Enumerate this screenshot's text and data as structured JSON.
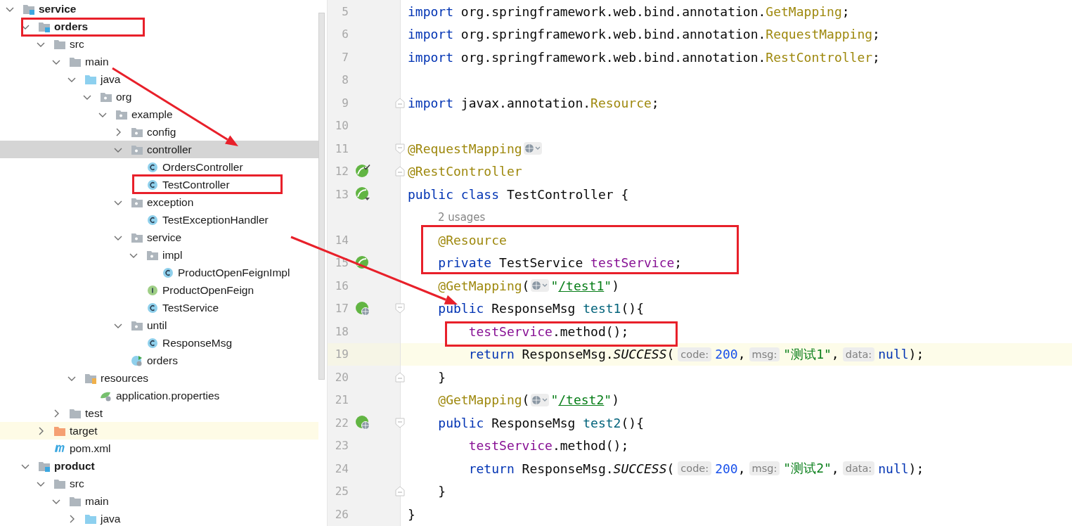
{
  "project_tree": {
    "items": [
      {
        "label": "service",
        "kind": "module",
        "bold": true,
        "selected": false,
        "expanded": true,
        "children": [
          {
            "label": "orders",
            "kind": "module",
            "bold": true,
            "selected": false,
            "expanded": true,
            "children": [
              {
                "label": "src",
                "kind": "folder",
                "bold": false,
                "selected": false,
                "expanded": true,
                "children": [
                  {
                    "label": "main",
                    "kind": "folder",
                    "bold": false,
                    "selected": false,
                    "expanded": true,
                    "children": [
                      {
                        "label": "java",
                        "kind": "source",
                        "bold": false,
                        "selected": false,
                        "expanded": true,
                        "children": [
                          {
                            "label": "org",
                            "kind": "package",
                            "bold": false,
                            "selected": false,
                            "expanded": true,
                            "children": [
                              {
                                "label": "example",
                                "kind": "package",
                                "bold": false,
                                "selected": false,
                                "expanded": true,
                                "children": [
                                  {
                                    "label": "config",
                                    "kind": "package",
                                    "bold": false,
                                    "selected": false,
                                    "expanded": false
                                  },
                                  {
                                    "label": "controller",
                                    "kind": "package",
                                    "bold": false,
                                    "selected": true,
                                    "expanded": true,
                                    "children": [
                                      {
                                        "label": "OrdersController",
                                        "kind": "class",
                                        "bold": false,
                                        "selected": false
                                      },
                                      {
                                        "label": "TestController",
                                        "kind": "class",
                                        "bold": false,
                                        "selected": false
                                      }
                                    ]
                                  },
                                  {
                                    "label": "exception",
                                    "kind": "package",
                                    "bold": false,
                                    "selected": false,
                                    "expanded": true,
                                    "children": [
                                      {
                                        "label": "TestExceptionHandler",
                                        "kind": "class",
                                        "bold": false,
                                        "selected": false
                                      }
                                    ]
                                  },
                                  {
                                    "label": "service",
                                    "kind": "package",
                                    "bold": false,
                                    "selected": false,
                                    "expanded": true,
                                    "children": [
                                      {
                                        "label": "impl",
                                        "kind": "package",
                                        "bold": false,
                                        "selected": false,
                                        "expanded": true,
                                        "children": [
                                          {
                                            "label": "ProductOpenFeignImpl",
                                            "kind": "class",
                                            "bold": false,
                                            "selected": false
                                          }
                                        ]
                                      },
                                      {
                                        "label": "ProductOpenFeign",
                                        "kind": "interface",
                                        "bold": false,
                                        "selected": false
                                      },
                                      {
                                        "label": "TestService",
                                        "kind": "class",
                                        "bold": false,
                                        "selected": false
                                      }
                                    ]
                                  },
                                  {
                                    "label": "until",
                                    "kind": "package",
                                    "bold": false,
                                    "selected": false,
                                    "expanded": true,
                                    "children": [
                                      {
                                        "label": "ResponseMsg",
                                        "kind": "class",
                                        "bold": false,
                                        "selected": false
                                      }
                                    ]
                                  },
                                  {
                                    "label": "orders",
                                    "kind": "bootclass",
                                    "bold": false,
                                    "selected": false
                                  }
                                ]
                              }
                            ]
                          }
                        ]
                      },
                      {
                        "label": "resources",
                        "kind": "resources",
                        "bold": false,
                        "selected": false,
                        "expanded": true,
                        "children": [
                          {
                            "label": "application.properties",
                            "kind": "config",
                            "bold": false,
                            "selected": false
                          }
                        ]
                      }
                    ]
                  },
                  {
                    "label": "test",
                    "kind": "folder",
                    "bold": false,
                    "selected": false,
                    "expanded": false
                  }
                ]
              },
              {
                "label": "target",
                "kind": "excluded",
                "bold": false,
                "selected": false,
                "expanded": false
              },
              {
                "label": "pom.xml",
                "kind": "maven",
                "bold": false,
                "selected": false
              }
            ]
          },
          {
            "label": "product",
            "kind": "module",
            "bold": true,
            "selected": false,
            "expanded": true,
            "children": [
              {
                "label": "src",
                "kind": "folder",
                "bold": false,
                "selected": false,
                "expanded": true,
                "children": [
                  {
                    "label": "main",
                    "kind": "folder",
                    "bold": false,
                    "selected": false,
                    "expanded": true,
                    "children": [
                      {
                        "label": "java",
                        "kind": "source",
                        "bold": false,
                        "selected": false,
                        "expanded": false
                      }
                    ]
                  }
                ]
              }
            ]
          }
        ]
      }
    ]
  },
  "editor": {
    "lines": [
      {
        "kind": "code",
        "number": "5",
        "current": false,
        "tokens": [
          {
            "kind": "kw",
            "text": "import"
          },
          {
            "kind": "plain",
            "text": " org.springframework.web.bind.annotation."
          },
          {
            "kind": "ann",
            "text": "GetMapping"
          },
          {
            "kind": "plain",
            "text": ";"
          }
        ]
      },
      {
        "kind": "code",
        "number": "6",
        "current": false,
        "tokens": [
          {
            "kind": "kw",
            "text": "import"
          },
          {
            "kind": "plain",
            "text": " org.springframework.web.bind.annotation."
          },
          {
            "kind": "ann",
            "text": "RequestMapping"
          },
          {
            "kind": "plain",
            "text": ";"
          }
        ]
      },
      {
        "kind": "code",
        "number": "7",
        "current": false,
        "tokens": [
          {
            "kind": "kw",
            "text": "import"
          },
          {
            "kind": "plain",
            "text": " org.springframework.web.bind.annotation."
          },
          {
            "kind": "ann",
            "text": "RestController"
          },
          {
            "kind": "plain",
            "text": ";"
          }
        ]
      },
      {
        "kind": "code",
        "number": "8",
        "current": false
      },
      {
        "kind": "code",
        "number": "9",
        "current": false,
        "markers": [
          {
            "kind": "fold-end"
          }
        ],
        "tokens": [
          {
            "kind": "kw",
            "text": "import"
          },
          {
            "kind": "plain",
            "text": " javax.annotation."
          },
          {
            "kind": "ann",
            "text": "Resource"
          },
          {
            "kind": "plain",
            "text": ";"
          }
        ]
      },
      {
        "kind": "code",
        "number": "10",
        "current": false
      },
      {
        "kind": "code",
        "number": "11",
        "current": false,
        "markers": [
          {
            "kind": "fold-start"
          }
        ],
        "tokens": [
          {
            "kind": "ann",
            "text": "@RequestMapping"
          },
          {
            "kind": "globe"
          }
        ]
      },
      {
        "kind": "code",
        "number": "12",
        "current": false,
        "markers": [
          {
            "kind": "bean-check"
          },
          {
            "kind": "fold-end"
          }
        ],
        "tokens": [
          {
            "kind": "ann",
            "text": "@RestController"
          }
        ]
      },
      {
        "kind": "code",
        "number": "13",
        "current": false,
        "markers": [
          {
            "kind": "bean-down"
          }
        ],
        "tokens": [
          {
            "kind": "kw",
            "text": "public class"
          },
          {
            "kind": "plain",
            "text": " TestController {"
          }
        ]
      },
      {
        "kind": "usages",
        "text": "2 usages"
      },
      {
        "kind": "code",
        "number": "14",
        "current": false,
        "tokens": [
          {
            "kind": "ann",
            "text": "    @Resource"
          }
        ]
      },
      {
        "kind": "code",
        "number": "15",
        "current": false,
        "markers": [
          {
            "kind": "bean"
          }
        ],
        "tokens": [
          {
            "kind": "kw",
            "text": "    private"
          },
          {
            "kind": "plain",
            "text": " TestService "
          },
          {
            "kind": "field",
            "text": "testService"
          },
          {
            "kind": "plain",
            "text": ";"
          }
        ]
      },
      {
        "kind": "code",
        "number": "16",
        "current": false,
        "tokens": [
          {
            "kind": "ann",
            "text": "    @GetMapping"
          },
          {
            "kind": "plain",
            "text": "("
          },
          {
            "kind": "globe"
          },
          {
            "kind": "str",
            "text": "\""
          },
          {
            "kind": "url",
            "text": "/test1"
          },
          {
            "kind": "str",
            "text": "\""
          },
          {
            "kind": "plain",
            "text": ")"
          }
        ]
      },
      {
        "kind": "code",
        "number": "17",
        "current": false,
        "markers": [
          {
            "kind": "web"
          },
          {
            "kind": "fold-start"
          }
        ],
        "tokens": [
          {
            "kind": "kw",
            "text": "    public"
          },
          {
            "kind": "plain",
            "text": " ResponseMsg "
          },
          {
            "kind": "fn",
            "text": "test1"
          },
          {
            "kind": "plain",
            "text": "(){"
          }
        ]
      },
      {
        "kind": "code",
        "number": "18",
        "current": false,
        "tokens": [
          {
            "kind": "field",
            "text": "        testService"
          },
          {
            "kind": "plain",
            "text": ".method();"
          }
        ]
      },
      {
        "kind": "code",
        "number": "19",
        "current": true,
        "tokens": [
          {
            "kind": "kw",
            "text": "        return"
          },
          {
            "kind": "plain",
            "text": " ResponseMsg."
          },
          {
            "kind": "static",
            "text": "SUCCESS"
          },
          {
            "kind": "plain",
            "text": "("
          },
          {
            "kind": "hint",
            "text": "code:"
          },
          {
            "kind": "num",
            "text": "200"
          },
          {
            "kind": "plain",
            "text": ","
          },
          {
            "kind": "hint",
            "text": "msg:"
          },
          {
            "kind": "str",
            "text": "\"测试1\""
          },
          {
            "kind": "plain",
            "text": ","
          },
          {
            "kind": "hint",
            "text": "data:"
          },
          {
            "kind": "kw",
            "text": "null"
          },
          {
            "kind": "plain",
            "text": ");"
          }
        ]
      },
      {
        "kind": "code",
        "number": "20",
        "current": false,
        "markers": [
          {
            "kind": "fold-end"
          }
        ],
        "tokens": [
          {
            "kind": "plain",
            "text": "    }"
          }
        ]
      },
      {
        "kind": "code",
        "number": "21",
        "current": false,
        "tokens": [
          {
            "kind": "ann",
            "text": "    @GetMapping"
          },
          {
            "kind": "plain",
            "text": "("
          },
          {
            "kind": "globe"
          },
          {
            "kind": "str",
            "text": "\""
          },
          {
            "kind": "url",
            "text": "/test2"
          },
          {
            "kind": "str",
            "text": "\""
          },
          {
            "kind": "plain",
            "text": ")"
          }
        ]
      },
      {
        "kind": "code",
        "number": "22",
        "current": false,
        "markers": [
          {
            "kind": "web"
          },
          {
            "kind": "fold-start"
          }
        ],
        "tokens": [
          {
            "kind": "kw",
            "text": "    public"
          },
          {
            "kind": "plain",
            "text": " ResponseMsg "
          },
          {
            "kind": "fn",
            "text": "test2"
          },
          {
            "kind": "plain",
            "text": "(){"
          }
        ]
      },
      {
        "kind": "code",
        "number": "23",
        "current": false,
        "tokens": [
          {
            "kind": "field",
            "text": "        testService"
          },
          {
            "kind": "plain",
            "text": ".method();"
          }
        ]
      },
      {
        "kind": "code",
        "number": "24",
        "current": false,
        "tokens": [
          {
            "kind": "kw",
            "text": "        return"
          },
          {
            "kind": "plain",
            "text": " ResponseMsg."
          },
          {
            "kind": "static",
            "text": "SUCCESS"
          },
          {
            "kind": "plain",
            "text": "("
          },
          {
            "kind": "hint",
            "text": "code:"
          },
          {
            "kind": "num",
            "text": "200"
          },
          {
            "kind": "plain",
            "text": ","
          },
          {
            "kind": "hint",
            "text": "msg:"
          },
          {
            "kind": "str",
            "text": "\"测试2\""
          },
          {
            "kind": "plain",
            "text": ","
          },
          {
            "kind": "hint",
            "text": "data:"
          },
          {
            "kind": "kw",
            "text": "null"
          },
          {
            "kind": "plain",
            "text": ");"
          }
        ]
      },
      {
        "kind": "code",
        "number": "25",
        "current": false,
        "markers": [
          {
            "kind": "fold-end"
          }
        ],
        "tokens": [
          {
            "kind": "plain",
            "text": "    }"
          }
        ]
      },
      {
        "kind": "code",
        "number": "26",
        "current": false,
        "tokens": [
          {
            "kind": "plain",
            "text": "}"
          }
        ]
      }
    ]
  }
}
